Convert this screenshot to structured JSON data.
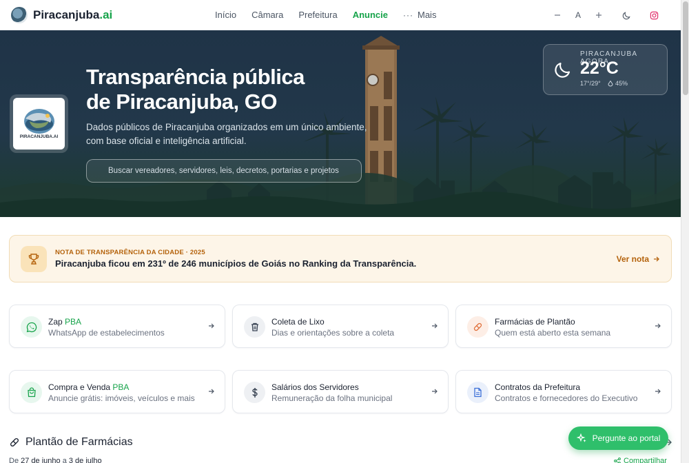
{
  "header": {
    "brand_name": "Piracanjuba",
    "brand_suffix": ".ai",
    "nav": [
      {
        "label": "Início"
      },
      {
        "label": "Câmara"
      },
      {
        "label": "Prefeitura"
      },
      {
        "label": "Anuncie"
      },
      {
        "label": "Mais"
      }
    ],
    "font_small": "A",
    "accent_color": "#16a34a"
  },
  "hero": {
    "title_line1": "Transparência pública",
    "title_line2": "de Piracanjuba, GO",
    "subtitle_line1": "Dados públicos de Piracanjuba organizados em um único ambiente,",
    "subtitle_line2": "com base oficial e inteligência artificial.",
    "search_placeholder": "Buscar vereadores, servidores, leis, decretos, portarias e projetos",
    "seal_text": "PIRACANJUBA.AI"
  },
  "weather": {
    "label": "PIRACANJUBA AGORA",
    "temp": "22°C",
    "range": "17°/29°",
    "humidity": "45%"
  },
  "note": {
    "kicker": "NOTA DE TRANSPARÊNCIA DA CIDADE · 2025",
    "text": "Piracanjuba ficou em 231º de 246 municípios de Goiás no Ranking da Transparência.",
    "link": "Ver nota",
    "color": "#b4620b"
  },
  "cards": [
    {
      "title": "Zap",
      "title_accent": "PBA",
      "desc": "WhatsApp de estabelecimentos",
      "icon": "whatsapp-icon"
    },
    {
      "title": "Coleta de Lixo",
      "title_accent": "",
      "desc": "Dias e orientações sobre a coleta",
      "icon": "trash-icon"
    },
    {
      "title": "Farmácias de Plantão",
      "title_accent": "",
      "desc": "Quem está aberto esta semana",
      "icon": "pill-icon"
    },
    {
      "title": "Compra e Venda",
      "title_accent": "PBA",
      "desc": "Anuncie grátis: imóveis, veículos e mais",
      "icon": "shopping-bag-icon"
    },
    {
      "title": "Salários dos Servidores",
      "title_accent": "",
      "desc": "Remuneração da folha municipal",
      "icon": "dollar-icon"
    },
    {
      "title": "Contratos da Prefeitura",
      "title_accent": "",
      "desc": "Contratos e fornecedores do Executivo",
      "icon": "document-icon"
    }
  ],
  "pharmacy_section": {
    "title": "Plantão de Farmácias",
    "date_prefix": "De",
    "date_start": "27 de junho",
    "date_joiner": "a",
    "date_end": "3 de julho",
    "share": "Compartilhar"
  },
  "fab": {
    "label": "Pergunte ao portal"
  }
}
